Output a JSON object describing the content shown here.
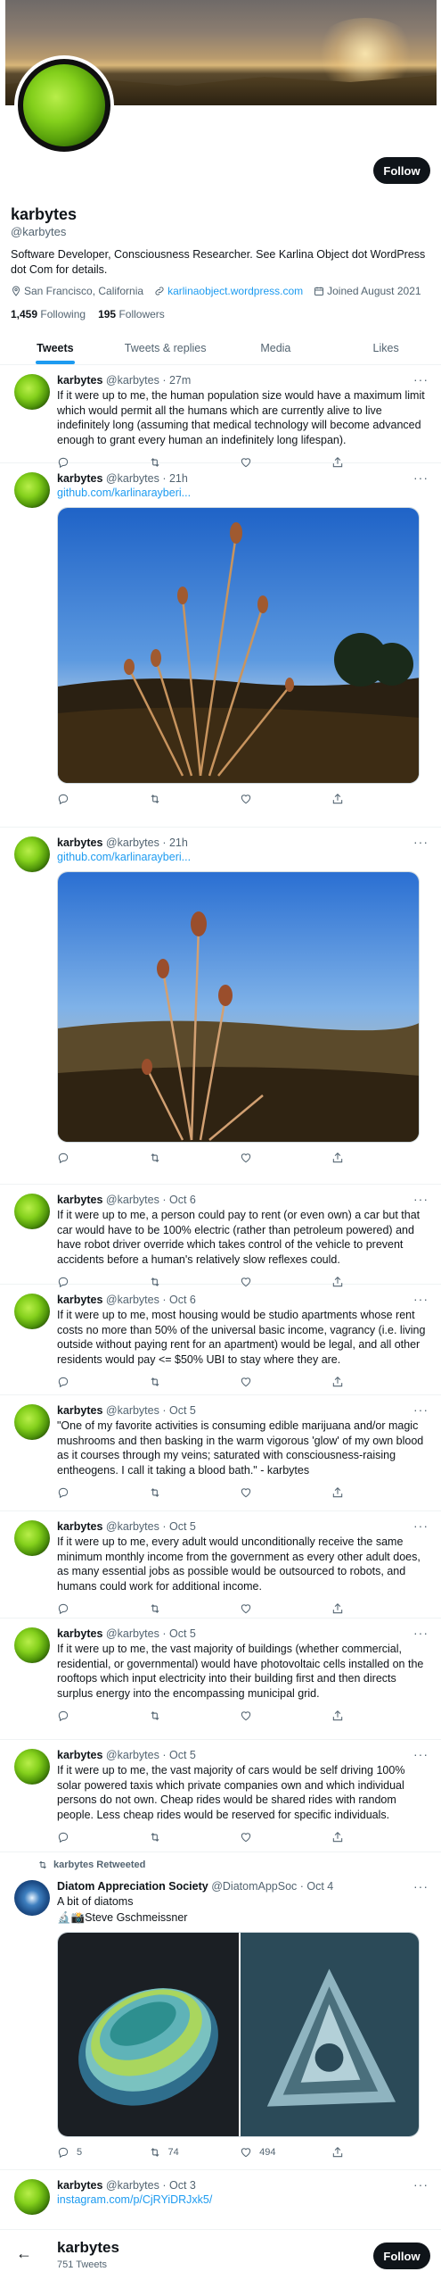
{
  "profile": {
    "name": "karbytes",
    "handle": "@karbytes",
    "bio": "Software Developer, Consciousness Researcher. See Karlina Object dot WordPress dot Com for details.",
    "location": "San Francisco, California",
    "website": "karlinaobject.wordpress.com",
    "joined": "Joined August 2021",
    "following_count": "1,459",
    "following_label": "Following",
    "followers_count": "195",
    "followers_label": "Followers",
    "follow_label": "Follow"
  },
  "tabs": [
    {
      "label": "Tweets",
      "active": true
    },
    {
      "label": "Tweets & replies",
      "active": false
    },
    {
      "label": "Media",
      "active": false
    },
    {
      "label": "Likes",
      "active": false
    }
  ],
  "tweets": [
    {
      "name": "karbytes",
      "handle": "@karbytes",
      "time": "27m",
      "text": "If it were up to me, the human population size would have a maximum limit which would permit all the humans which are currently alive to live indefinitely long (assuming that medical technology will become advanced enough to grant every human an indefinitely long lifespan)."
    },
    {
      "name": "karbytes",
      "handle": "@karbytes",
      "time": "21h",
      "link": "github.com/karlinarayberi..."
    },
    {
      "name": "karbytes",
      "handle": "@karbytes",
      "time": "21h",
      "link": "github.com/karlinarayberi..."
    },
    {
      "name": "karbytes",
      "handle": "@karbytes",
      "time": "Oct 6",
      "text": "If it were up to me, a person could pay to rent (or even own) a car but that car would have to be 100% electric (rather than petroleum powered) and have robot driver override which takes control of the vehicle to prevent accidents before a human's relatively slow reflexes could."
    },
    {
      "name": "karbytes",
      "handle": "@karbytes",
      "time": "Oct 6",
      "text": "If it were up to me, most housing would be studio apartments whose rent costs no more than 50% of the universal basic income, vagrancy (i.e. living outside without paying rent for an apartment) would be legal, and all other residents would pay <= $50% UBI to stay where they are."
    },
    {
      "name": "karbytes",
      "handle": "@karbytes",
      "time": "Oct 5",
      "text": "\"One of my favorite activities is consuming edible marijuana and/or magic mushrooms and then basking in the warm vigorous 'glow' of my own blood as it courses through my veins; saturated with consciousness-raising entheogens. I call it taking a blood bath.\" - karbytes"
    },
    {
      "name": "karbytes",
      "handle": "@karbytes",
      "time": "Oct 5",
      "text": "If it were up to me, every adult would unconditionally receive the same minimum monthly income from the government as every other adult does, as many essential jobs as possible would be outsourced to robots, and humans could work for additional income."
    },
    {
      "name": "karbytes",
      "handle": "@karbytes",
      "time": "Oct 5",
      "text": "If it were up to me, the vast majority of buildings (whether commercial, residential, or governmental) would have photovoltaic cells installed on the rooftops which input electricity into their building first and then directs surplus energy into the encompassing municipal grid."
    },
    {
      "name": "karbytes",
      "handle": "@karbytes",
      "time": "Oct 5",
      "text": "If it were up to me, the vast majority of cars would be self driving 100% solar powered taxis which private companies own and which individual persons do not own. Cheap rides would be shared rides with random people. Less cheap rides would be reserved for specific individuals."
    },
    {
      "retweeted_by": "karbytes Retweeted",
      "name": "Diatom Appreciation Society",
      "handle": "@DiatomAppSoc",
      "time": "Oct 4",
      "text": "A bit of diatoms",
      "credit": "Steve Gschmeissner",
      "replies": "5",
      "retweets": "74",
      "likes": "494"
    },
    {
      "name": "karbytes",
      "handle": "@karbytes",
      "time": "Oct 3",
      "link": "instagram.com/p/CjRYiDRJxk5/"
    }
  ],
  "bottom_bar": {
    "name": "karbytes",
    "count": "751 Tweets",
    "follow_label": "Follow"
  },
  "colors": {
    "accent": "#1d9bf0",
    "text": "#0f1419",
    "muted": "#536471"
  }
}
